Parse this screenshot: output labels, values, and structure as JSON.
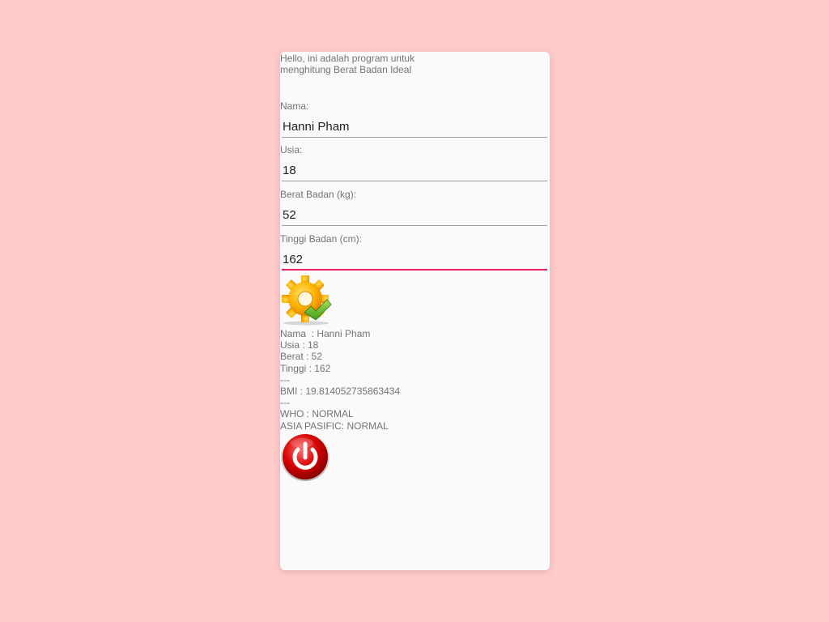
{
  "intro": {
    "line1": "Hello, ini adalah program untuk",
    "line2": "menghitung Berat Badan Ideal"
  },
  "form": {
    "nama_label": "Nama:",
    "nama_value": "Hanni Pham",
    "usia_label": "Usia:",
    "usia_value": "18",
    "berat_label": "Berat Badan (kg):",
    "berat_value": "52",
    "tinggi_label": "Tinggi Badan (cm):",
    "tinggi_value": "162"
  },
  "buttons": {
    "calculate_icon": "gear-check-icon",
    "exit_icon": "power-icon"
  },
  "result": {
    "nama": "Nama  : Hanni Pham",
    "usia": "Usia : 18",
    "berat": "Berat : 52",
    "tinggi": "Tinggi : 162",
    "sep1": "---",
    "bmi": "BMI : 19.814052735863434",
    "sep2": "---",
    "who": "WHO : NORMAL",
    "asia": "ASIA PASIFIC: NORMAL"
  },
  "colors": {
    "background": "#ffcaca",
    "accent": "#e91e63",
    "text": "#737373"
  }
}
